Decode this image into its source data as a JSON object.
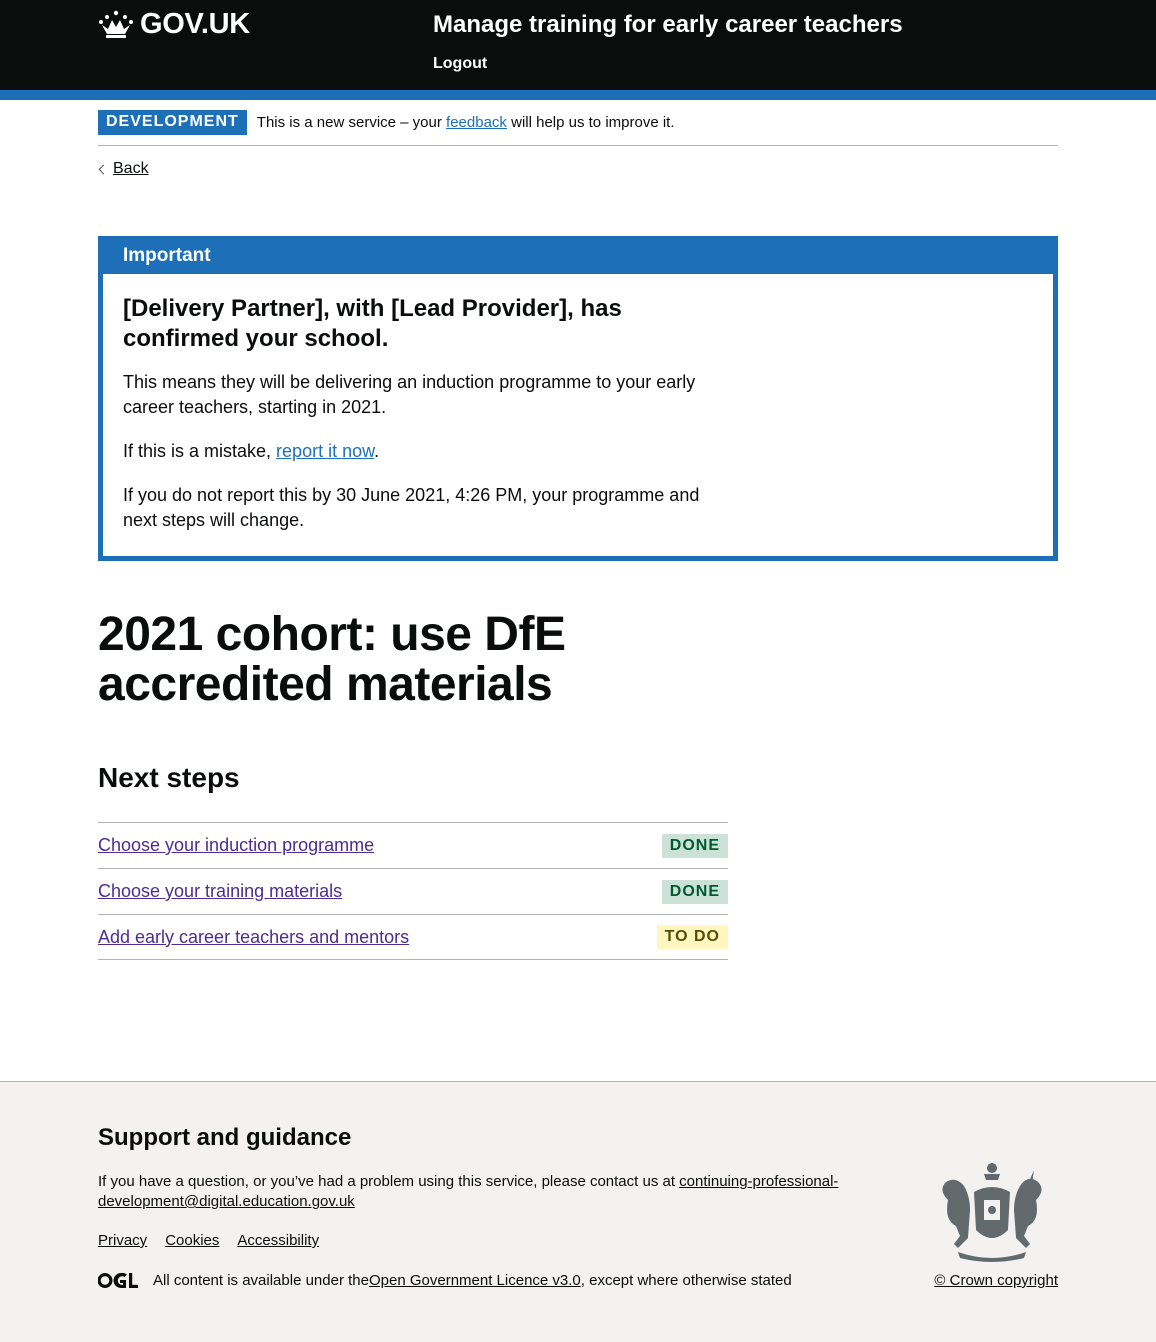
{
  "header": {
    "logo_text": "GOV.UK",
    "service_name": "Manage training for early career teachers",
    "nav_logout": "Logout"
  },
  "phase_banner": {
    "tag": "DEVELOPMENT",
    "text_before": "This is a new service – your ",
    "link": "feedback",
    "text_after": " will help us to improve it."
  },
  "back_link": "Back",
  "notification": {
    "title": "Important",
    "heading": "[Delivery Partner], with [Lead Provider], has confirmed your school.",
    "p1": "This means they will be delivering an induction programme to your early career teachers, starting in 2021.",
    "p2_before": "If this is a mistake, ",
    "p2_link": "report it now",
    "p2_after": ".",
    "p3": "If you do not report this by 30 June 2021, 4:26 PM, your programme and next steps will change."
  },
  "page_title": "2021 cohort: use DfE accredited materials",
  "next_steps": {
    "title": "Next steps",
    "tasks": [
      {
        "label": "Choose your induction programme",
        "status": "DONE"
      },
      {
        "label": "Choose your training materials",
        "status": "DONE"
      },
      {
        "label": "Add early career teachers and mentors",
        "status": "TO DO"
      }
    ]
  },
  "footer": {
    "title": "Support and guidance",
    "contact_text": "If you have a question, or you’ve had a problem using this service, please contact us at ",
    "contact_email": "continuing-professional-development@digital.education.gov.uk",
    "links": [
      "Privacy",
      "Cookies",
      "Accessibility"
    ],
    "licence_before": "All content is available under the ",
    "licence_link": "Open Government Licence v3.0",
    "licence_after": ", except where otherwise stated",
    "copyright": "© Crown copyright"
  }
}
